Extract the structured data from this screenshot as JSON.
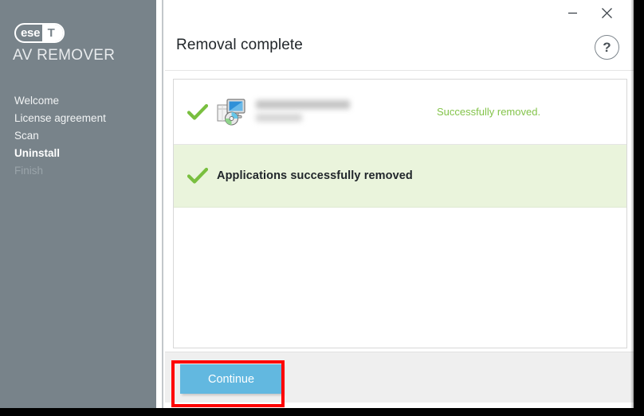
{
  "window": {
    "minimize_label": "Minimize",
    "close_label": "Close"
  },
  "sidebar": {
    "logo": {
      "text_left": "ese",
      "text_right": "T",
      "name": "eset-logo"
    },
    "product": "AV REMOVER",
    "items": [
      {
        "label": "Welcome",
        "state": "done"
      },
      {
        "label": "License agreement",
        "state": "done"
      },
      {
        "label": "Scan",
        "state": "done"
      },
      {
        "label": "Uninstall",
        "state": "active"
      },
      {
        "label": "Finish",
        "state": "disabled"
      }
    ]
  },
  "header": {
    "title": "Removal complete",
    "help_label": "?"
  },
  "results": {
    "rows": [
      {
        "type": "application",
        "icon": "add-remove-programs-icon",
        "check_icon": "green-check-icon",
        "app_name": "",
        "app_name_redacted": true,
        "status": "Successfully removed."
      },
      {
        "type": "summary",
        "check_icon": "green-check-icon",
        "text": "Applications successfully removed"
      }
    ]
  },
  "footer": {
    "continue_label": "Continue"
  },
  "colors": {
    "sidebar_bg": "#78838a",
    "accent_blue": "#62b8e0",
    "success_green": "#84c44b",
    "summary_bg": "#eaf4dc",
    "highlight_red": "#ff0000",
    "footer_bg": "#efefef"
  }
}
